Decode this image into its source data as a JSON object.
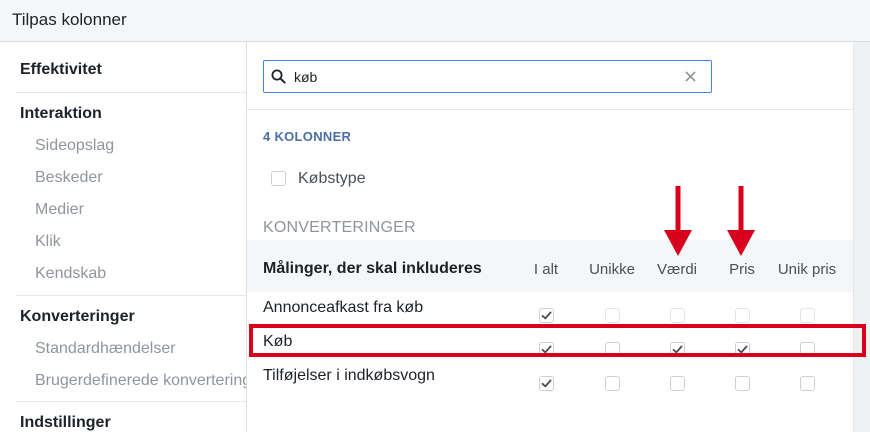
{
  "window": {
    "title": "Tilpas kolonner"
  },
  "sidebar": {
    "sections": [
      {
        "title": "Effektivitet",
        "items": []
      },
      {
        "title": "Interaktion",
        "items": [
          "Sideopslag",
          "Beskeder",
          "Medier",
          "Klik",
          "Kendskab"
        ]
      },
      {
        "title": "Konverteringer",
        "items": [
          "Standardhændelser",
          "Brugerdefinerede konverteringer"
        ]
      },
      {
        "title": "Indstillinger",
        "items": []
      }
    ]
  },
  "search": {
    "value": "køb",
    "icon": "search-icon",
    "clear_icon": "close-icon"
  },
  "results": {
    "count_label": "4 KOLONNER",
    "standalone": {
      "label": "Købstype",
      "checked": false
    },
    "section_title": "KONVERTERINGER",
    "table": {
      "header_label": "Målinger, der skal inkluderes",
      "columns": [
        "I alt",
        "Unikke",
        "Værdi",
        "Pris",
        "Unik pris"
      ],
      "rows": [
        {
          "label": "Annonceafkast fra køb",
          "checks": [
            true,
            false,
            false,
            false,
            false
          ],
          "enabled": [
            true,
            false,
            false,
            false,
            false
          ]
        },
        {
          "label": "Køb",
          "checks": [
            true,
            false,
            true,
            true,
            false
          ],
          "enabled": [
            true,
            true,
            true,
            true,
            true
          ]
        },
        {
          "label": "Tilføjelser i indkøbsvogn",
          "checks": [
            true,
            false,
            false,
            false,
            false
          ],
          "enabled": [
            true,
            true,
            true,
            true,
            true
          ]
        }
      ]
    }
  },
  "annotations": {
    "highlight_color": "#d8001c",
    "arrow_columns": [
      "Værdi",
      "Pris"
    ]
  },
  "colors": {
    "accent": "#4080ff",
    "count_label": "#4b6fa8"
  }
}
